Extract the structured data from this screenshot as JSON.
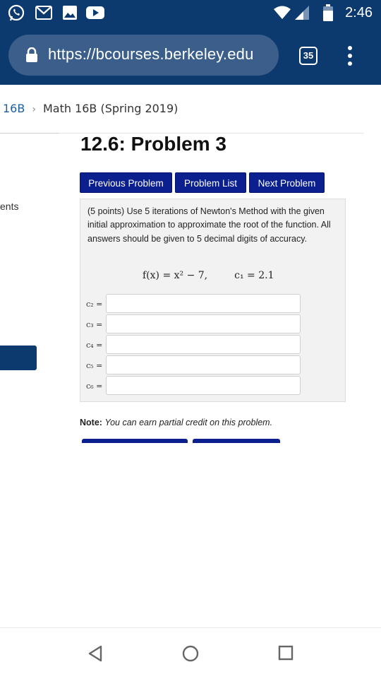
{
  "status_bar": {
    "time": "2:46",
    "icons": [
      "whatsapp-icon",
      "gmail-icon",
      "image-icon",
      "youtube-icon",
      "wifi-icon",
      "signal-icon",
      "battery-icon"
    ]
  },
  "browser": {
    "url": "https://bcourses.berkeley.edu",
    "tab_count": "35"
  },
  "breadcrumb": {
    "course_short": "16B",
    "separator": "›",
    "current": "Math 16B (Spring 2019)"
  },
  "sidebar": {
    "partial_text": "ents"
  },
  "page": {
    "title": "12.6: Problem 3",
    "nav_buttons": {
      "previous": "Previous Problem",
      "list": "Problem List",
      "next": "Next Problem"
    },
    "problem": {
      "text": "(5 points) Use 5 iterations of Newton's Method with the given initial approximation to approximate the root of the function. All answers should be given to 5 decimal digits of accuracy.",
      "formula_fx": "f(x) = x² − 7,",
      "formula_c1": "c₁ = 2.1",
      "answers": [
        {
          "label": "c₂ =",
          "value": ""
        },
        {
          "label": "c₃ =",
          "value": ""
        },
        {
          "label": "c₄ =",
          "value": ""
        },
        {
          "label": "c₅ =",
          "value": ""
        },
        {
          "label": "c₆ =",
          "value": ""
        }
      ]
    },
    "note_label": "Note:",
    "note_text": "You can earn partial credit on this problem."
  },
  "colors": {
    "header_bg": "#0d3a6e",
    "button_bg": "#0b1f8f",
    "link": "#1d5e9b"
  }
}
